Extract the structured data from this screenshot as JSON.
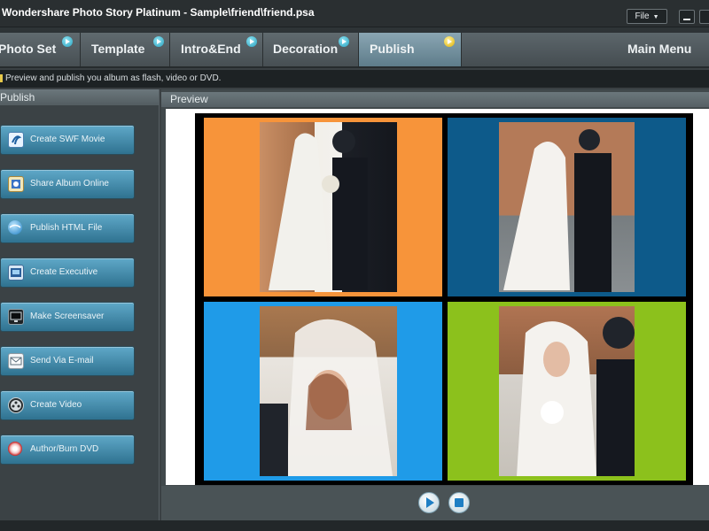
{
  "window": {
    "title": "Wondershare Photo Story Platinum - Sample\\friend\\friend.psa",
    "file_menu": "File"
  },
  "tabs": [
    {
      "label": "Photo Set",
      "active": false
    },
    {
      "label": "Template",
      "active": false
    },
    {
      "label": "Intro&End",
      "active": false
    },
    {
      "label": "Decoration",
      "active": false
    },
    {
      "label": "Publish",
      "active": true
    },
    {
      "label": "Main Menu",
      "active": false
    }
  ],
  "hint": "Preview and publish you album as flash, video or DVD.",
  "publish_panel": {
    "header": "Publish",
    "buttons": [
      {
        "label": "Create SWF Movie",
        "icon": "swf-movie-icon"
      },
      {
        "label": "Share Album Online",
        "icon": "share-online-icon"
      },
      {
        "label": "Publish HTML File",
        "icon": "html-file-icon"
      },
      {
        "label": "Create Executive",
        "icon": "executable-icon"
      },
      {
        "label": "Make Screensaver",
        "icon": "screensaver-icon"
      },
      {
        "label": "Send Via E-mail",
        "icon": "email-icon"
      },
      {
        "label": "Create Video",
        "icon": "video-reel-icon"
      },
      {
        "label": "Author/Burn DVD",
        "icon": "dvd-disc-icon"
      }
    ]
  },
  "preview": {
    "header": "Preview",
    "cells": [
      {
        "bg": "#f7943a",
        "photo": "wedding-photo-1"
      },
      {
        "bg": "#0d5a8a",
        "photo": "wedding-photo-2"
      },
      {
        "bg": "#1f9be8",
        "photo": "wedding-photo-3"
      },
      {
        "bg": "#8cc11c",
        "photo": "wedding-photo-4"
      }
    ],
    "controls": [
      "play-button",
      "stop-button"
    ]
  }
}
